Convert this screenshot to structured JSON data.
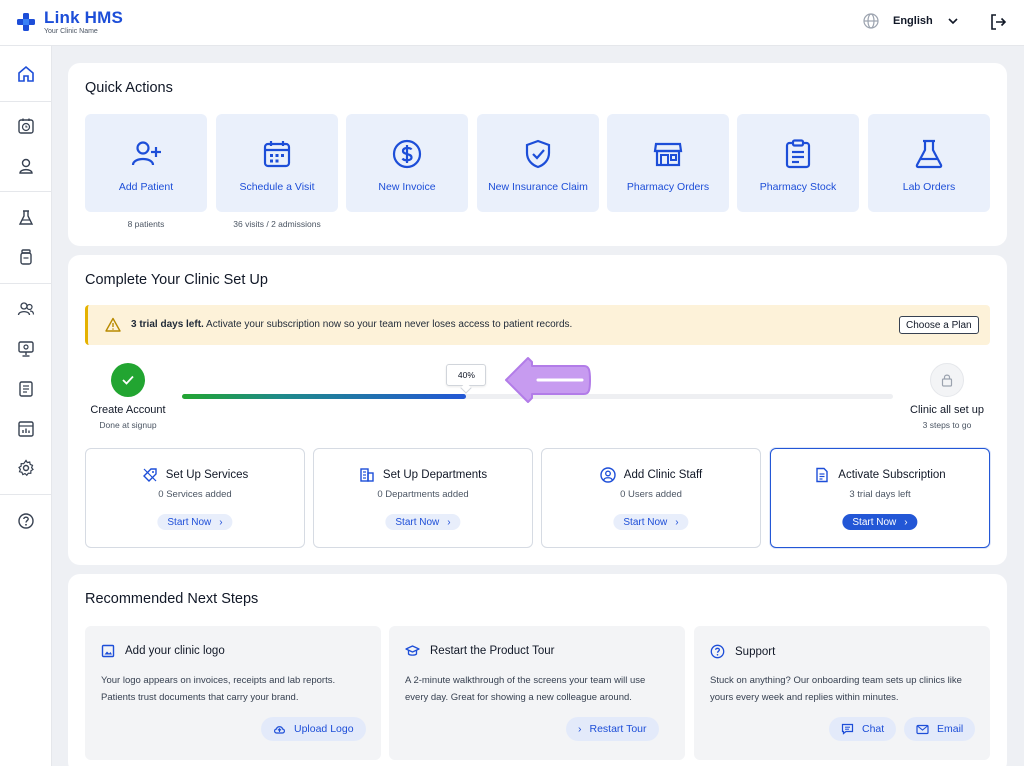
{
  "app": {
    "brand": "Link HMS",
    "clinic_name": "Your Clinic Name",
    "language": "English",
    "brand_color": "#1d4ed8"
  },
  "sidebar": {
    "items": [
      {
        "icon": "home-icon"
      },
      {
        "icon": "calendar-clock-icon"
      },
      {
        "icon": "user-icon"
      },
      {
        "icon": "lab-flask-icon"
      },
      {
        "icon": "medicine-bottle-icon"
      },
      {
        "icon": "users-icon"
      },
      {
        "icon": "monitor-icon"
      },
      {
        "icon": "report-icon"
      },
      {
        "icon": "analytics-icon"
      },
      {
        "icon": "gear-icon"
      },
      {
        "icon": "help-icon"
      }
    ]
  },
  "quick_actions": {
    "title": "Quick Actions",
    "tiles": [
      {
        "label": "Add Patient",
        "sub": "8 patients",
        "icon": "add-user-icon"
      },
      {
        "label": "Schedule a Visit",
        "sub": "36 visits / 2 admissions",
        "icon": "calendar-icon"
      },
      {
        "label": "New Invoice",
        "sub": "",
        "icon": "dollar-icon"
      },
      {
        "label": "New Insurance Claim",
        "sub": "",
        "icon": "shield-check-icon"
      },
      {
        "label": "Pharmacy Orders",
        "sub": "",
        "icon": "store-icon"
      },
      {
        "label": "Pharmacy Stock",
        "sub": "",
        "icon": "clipboard-icon"
      },
      {
        "label": "Lab Orders",
        "sub": "",
        "icon": "flask-icon"
      }
    ]
  },
  "setup": {
    "title": "Complete Your Clinic Set Up",
    "trial": {
      "bold": "3 trial days left.",
      "text": "Activate your subscription now so your team never loses access to patient records.",
      "button": "Choose a Plan"
    },
    "progress": {
      "percent": 40,
      "percent_label": "40%",
      "start_label": "Create Account",
      "start_sub": "Done at signup",
      "end_label": "Clinic all set up",
      "end_sub": "3 steps to go"
    },
    "tiles": [
      {
        "title": "Set Up Services",
        "sub": "0 Services added",
        "button": "Start Now",
        "icon": "tag-icon",
        "active": false
      },
      {
        "title": "Set Up Departments",
        "sub": "0 Departments added",
        "button": "Start Now",
        "icon": "building-icon",
        "active": false
      },
      {
        "title": "Add Clinic Staff",
        "sub": "0 Users added",
        "button": "Start Now",
        "icon": "user-circle-icon",
        "active": false
      },
      {
        "title": "Activate Subscription",
        "sub": "3 trial days left",
        "button": "Start Now",
        "icon": "document-icon",
        "active": true
      }
    ]
  },
  "recommended": {
    "title": "Recommended Next Steps",
    "tiles": [
      {
        "title": "Add your clinic logo",
        "body": "Your logo appears on invoices, receipts and lab reports. Patients trust documents that carry your brand.",
        "buttons": [
          "Upload Logo"
        ],
        "icon": "image-icon"
      },
      {
        "title": "Restart the Product Tour",
        "body": "A 2-minute walkthrough of the screens your team will use every day. Great for showing a new colleague around.",
        "buttons": [
          "Restart Tour"
        ],
        "icon": "graduation-cap-icon"
      },
      {
        "title": "Support",
        "body": "Stuck on anything? Our onboarding team sets up clinics like yours every week and replies within minutes.",
        "buttons": [
          "Chat",
          "Email"
        ],
        "icon": "help-circle-icon"
      }
    ]
  }
}
